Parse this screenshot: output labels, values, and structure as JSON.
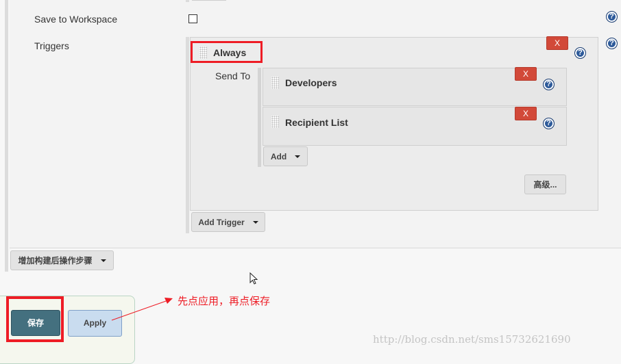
{
  "form": {
    "save_to_workspace_label": "Save to Workspace",
    "save_to_workspace_checked": false,
    "triggers_label": "Triggers",
    "trigger": {
      "name": "Always",
      "remove_label": "X",
      "send_to_label": "Send To",
      "recipients": [
        {
          "name": "Developers",
          "remove_label": "X"
        },
        {
          "name": "Recipient List",
          "remove_label": "X"
        }
      ],
      "add_label": "Add",
      "advanced_label": "高级..."
    },
    "add_trigger_label": "Add Trigger",
    "add_post_build_label": "增加构建后操作步骤",
    "help_glyph": "?"
  },
  "footer": {
    "save_label": "保存",
    "apply_label": "Apply"
  },
  "annotation": {
    "text": "先点应用，再点保存",
    "color": "#ee1c25"
  },
  "watermark": "http://blog.csdn.net/sms15732621690",
  "colors": {
    "save_button": "#44707f",
    "apply_button": "#c9dcef",
    "remove_button": "#d24939",
    "help_icon": "#2d5a9a"
  }
}
